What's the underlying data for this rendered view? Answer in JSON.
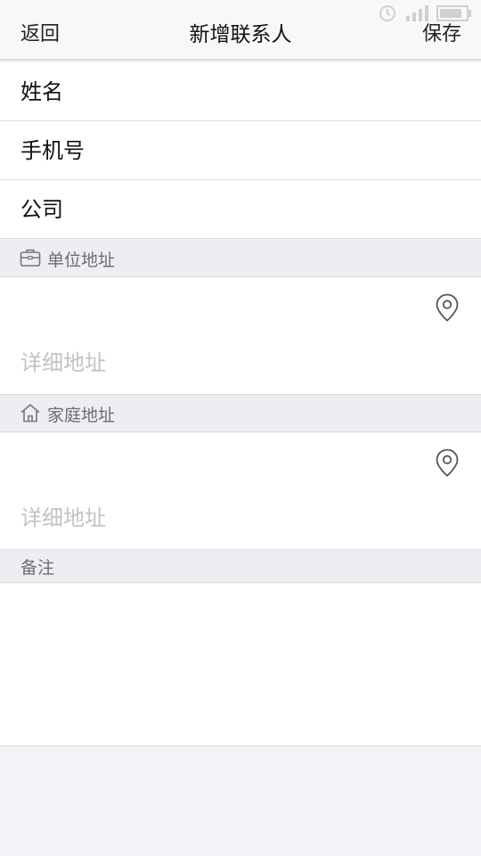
{
  "nav": {
    "back_label": "返回",
    "title": "新增联系人",
    "save_label": "保存"
  },
  "fields": {
    "name_placeholder": "姓名",
    "phone_placeholder": "手机号",
    "company_placeholder": "公司"
  },
  "work_address": {
    "header": "单位地址",
    "icon": "briefcase-icon",
    "detail_placeholder": "详细地址"
  },
  "home_address": {
    "header": "家庭地址",
    "icon": "home-icon",
    "detail_placeholder": "详细地址"
  },
  "notes": {
    "header": "备注"
  },
  "colors": {
    "background": "#f2f3f7",
    "section_header": "#eceef2",
    "placeholder": "#c2c2c2"
  }
}
